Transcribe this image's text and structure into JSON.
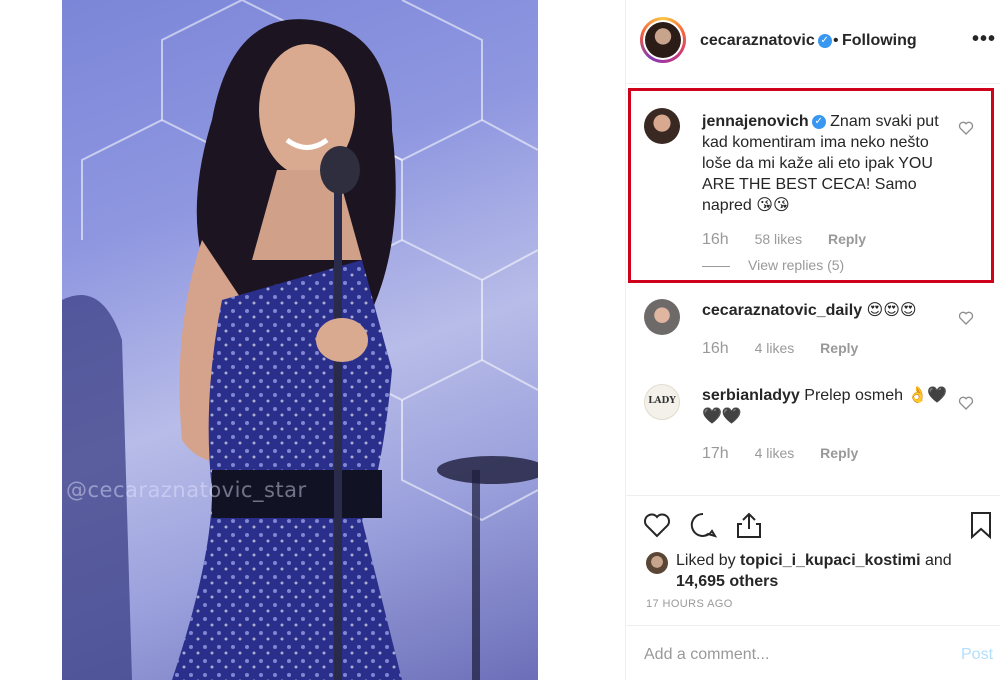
{
  "photo": {
    "watermark": "@cecaraznatovic_star"
  },
  "header": {
    "username": "cecaraznatovic",
    "verified_mark": "✓",
    "separator": "•",
    "follow_status": "Following",
    "more_label": "•••"
  },
  "comments": [
    {
      "username": "jennajenovich",
      "verified": true,
      "text": "Znam svaki put kad komentiram ima neko nešto loše da mi kaže ali eto ipak YOU ARE THE BEST CECA! Samo napred 😘😘",
      "time": "16h",
      "likes": "58 likes",
      "reply": "Reply",
      "view_replies": "View replies (5)"
    },
    {
      "username": "cecaraznatovic_daily",
      "text": "😍😍😍",
      "time": "16h",
      "likes": "4 likes",
      "reply": "Reply"
    },
    {
      "username": "serbianladyy",
      "avatar_text": "LADY",
      "text": "Prelep osmeh 👌🖤🖤🖤",
      "time": "17h",
      "likes": "4 likes",
      "reply": "Reply"
    }
  ],
  "actions": {
    "like_icon": "heart-icon",
    "comment_icon": "comment-icon",
    "share_icon": "share-icon",
    "save_icon": "bookmark-icon"
  },
  "likes": {
    "prefix": "Liked by ",
    "user": "topici_i_kupaci_kostimi",
    "middle": " and ",
    "others": "14,695 others"
  },
  "timestamp": "17 HOURS AGO",
  "add_comment": {
    "placeholder": "Add a comment...",
    "post_label": "Post"
  },
  "colors": {
    "highlight": "#d0021b",
    "verified": "#3897f0",
    "post_disabled": "#b2dffc"
  }
}
